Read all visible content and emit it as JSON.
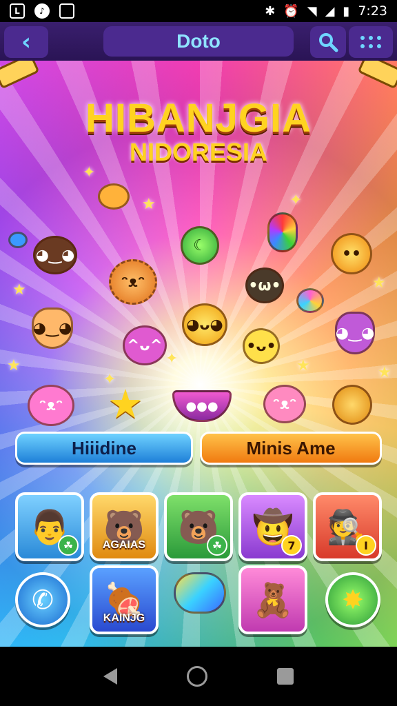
{
  "status_bar": {
    "time": "7:23",
    "left_icons": [
      "L",
      "♪",
      "□"
    ],
    "right_icons": [
      "bluetooth-icon",
      "alarm-icon",
      "wifi-icon",
      "signal-icon",
      "battery-icon"
    ]
  },
  "header": {
    "title": "Doto",
    "back_icon": "back-arrow-icon",
    "search_icon": "search-icon",
    "menu_icon": "grid-menu-icon"
  },
  "game": {
    "title": "HIBANJGIA",
    "subtitle": "NIDORESIA",
    "colors": {
      "title": "#ffd320",
      "btn_left": "#1e7fd8",
      "btn_right": "#f07a10"
    }
  },
  "buttons": {
    "left_label": "Hiiidine",
    "right_label": "Minis Ame"
  },
  "tiles": {
    "row1": [
      {
        "name": "man-portrait",
        "badge": "☘"
      },
      {
        "name": "bear-tile",
        "label": "AGAIAS"
      },
      {
        "name": "blue-bear-tile",
        "badge": "☘"
      },
      {
        "name": "cowboy-bear-tile",
        "badge": "7"
      },
      {
        "name": "hat-man-tile",
        "badge": "I"
      }
    ],
    "row2": [
      {
        "name": "phone-button"
      },
      {
        "name": "meat-tile",
        "label": "KAINJG"
      },
      {
        "name": "candy-item"
      },
      {
        "name": "bear-doctor-tile"
      },
      {
        "name": "star-button"
      }
    ]
  }
}
